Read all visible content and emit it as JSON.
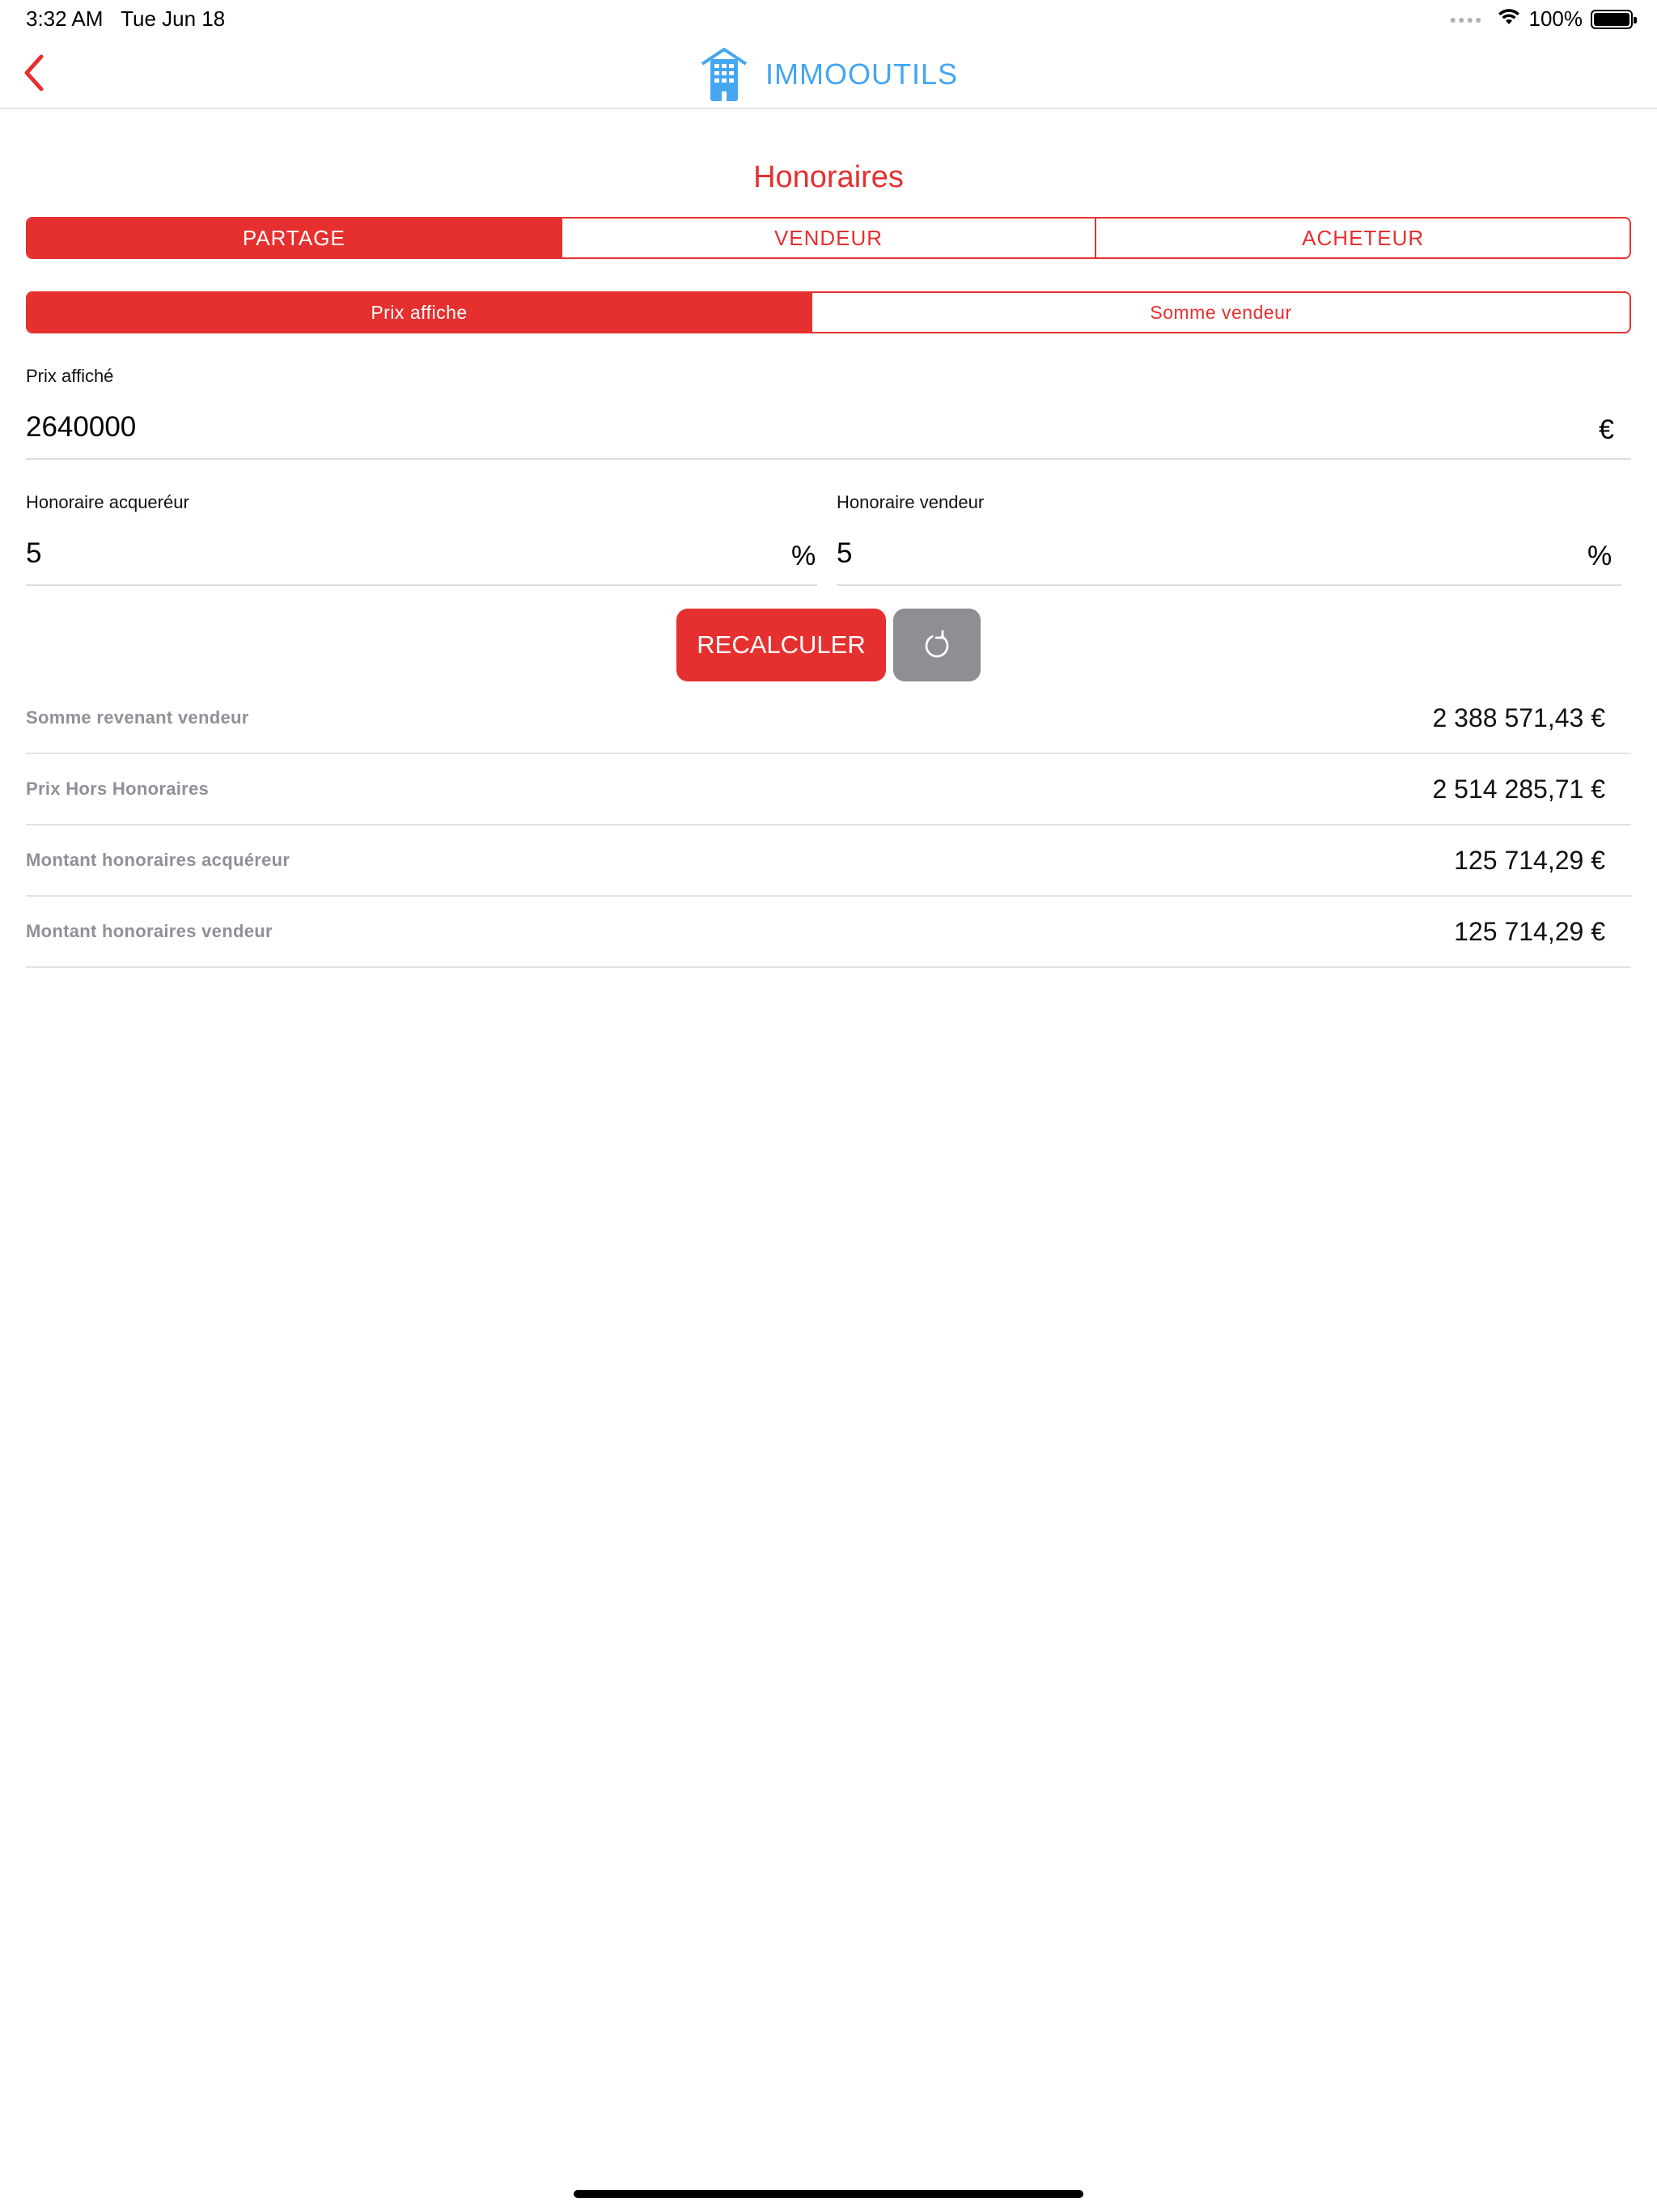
{
  "status_bar": {
    "time": "3:32 AM",
    "date": "Tue Jun 18",
    "battery": "100%"
  },
  "nav": {
    "app_name": "IMMOOUTILS"
  },
  "page": {
    "title": "Honoraires"
  },
  "main_tabs": [
    "PARTAGE",
    "VENDEUR",
    "ACHETEUR"
  ],
  "sub_tabs": [
    "Prix affiche",
    "Somme vendeur"
  ],
  "fields": {
    "prix": {
      "label": "Prix affiché",
      "value": "2640000",
      "unit": "€"
    },
    "acquereur": {
      "label": "Honoraire acqueréur",
      "value": "5",
      "unit": "%"
    },
    "vendeur": {
      "label": "Honoraire vendeur",
      "value": "5",
      "unit": "%"
    }
  },
  "buttons": {
    "recalculer": "RECALCULER"
  },
  "results": [
    {
      "label": "Somme revenant vendeur",
      "value": "2 388 571,43 €"
    },
    {
      "label": "Prix Hors Honoraires",
      "value": "2 514 285,71 €"
    },
    {
      "label": "Montant honoraires acquéreur",
      "value": "125 714,29 €"
    },
    {
      "label": "Montant honoraires vendeur",
      "value": "125 714,29 €"
    }
  ],
  "colors": {
    "accent": "#e63030",
    "brand": "#45a6f2",
    "secondary_button": "#8e8e93",
    "muted_label": "#909098"
  },
  "icons": {
    "back": "chevron-left-icon",
    "logo": "building-icon",
    "reset": "refresh-icon",
    "wifi": "wifi-icon",
    "battery": "battery-icon"
  }
}
